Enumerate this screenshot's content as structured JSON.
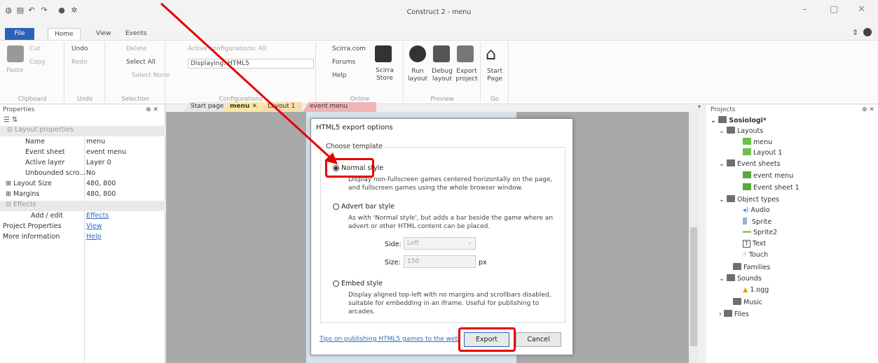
{
  "window": {
    "title": "Construct 2 - menu",
    "minimize": "–",
    "restore": "▢",
    "close": "✕"
  },
  "ribbon_tabs": [
    "File",
    "Home",
    "View",
    "Events"
  ],
  "ribbon": {
    "paste": "Paste",
    "cut": "Cut",
    "copy": "Copy",
    "undo": "Undo",
    "redo": "Redo",
    "delete": "Delete",
    "select_all": "Select All",
    "select_none": "Select None",
    "active_config": "Active configurations: All",
    "displaying": "Displaying: HTML5",
    "scirra": "Scirra.com",
    "forums": "Forums",
    "help": "Help",
    "store": "Scirra Store",
    "run": "Run layout",
    "debug": "Debug layout",
    "export": "Export project",
    "start": "Start Page",
    "groups": {
      "clipboard": "Clipboard",
      "undo": "Undo",
      "selection": "Selection",
      "configurations": "Configurations",
      "online": "Online",
      "preview": "Preview",
      "go": "Go"
    }
  },
  "properties": {
    "title": "Properties",
    "pin": "⊕ ✕",
    "rows": [
      {
        "k": "Layout properties",
        "v": ""
      },
      {
        "k": "Name",
        "v": "menu"
      },
      {
        "k": "Event sheet",
        "v": "event menu"
      },
      {
        "k": "Active layer",
        "v": "Layer 0"
      },
      {
        "k": "Unbounded scro...",
        "v": "No"
      },
      {
        "k": "Layout Size",
        "v": "480, 800"
      },
      {
        "k": "Margins",
        "v": "480, 800"
      },
      {
        "k": "Effects",
        "v": ""
      },
      {
        "k": "Add / edit",
        "v": "Effects"
      },
      {
        "k": "Project Properties",
        "v": "View"
      },
      {
        "k": "More information",
        "v": "Help"
      }
    ]
  },
  "doc_tabs": [
    "Start page",
    "menu",
    "Layout 1",
    "event menu"
  ],
  "dialog": {
    "title": "HTML5 export options",
    "group": "Choose template",
    "opt1": "Normal style",
    "opt1_desc": "Display non-fullscreen games centered horizontally on the page, and fullscreen games using the whole browser window.",
    "opt2": "Advert bar style",
    "opt2_desc": "As with 'Normal style', but adds a bar beside the game where an advert or other HTML content can be placed.",
    "side_label": "Side:",
    "side_value": "Left",
    "size_label": "Size:",
    "size_value": "150",
    "size_unit": "px",
    "opt3": "Embed style",
    "opt3_desc": "Display aligned top-left with no margins and scrollbars disabled, suitable for embedding in an iframe. Useful for publishing to arcades.",
    "tips": "Tips on publishing HTML5 games to the web",
    "export": "Export",
    "cancel": "Cancel"
  },
  "projects": {
    "title": "Projects",
    "project": "Sosiologi*",
    "layouts": "Layouts",
    "layout_items": [
      "menu",
      "Layout 1"
    ],
    "event_sheets": "Event sheets",
    "event_items": [
      "event menu",
      "Event sheet 1"
    ],
    "object_types": "Object types",
    "object_items": [
      "Audio",
      "Sprite",
      "Sprite2",
      "Text",
      "Touch"
    ],
    "families": "Families",
    "sounds": "Sounds",
    "sound_items": [
      "1.ogg"
    ],
    "music": "Music",
    "files": "Files"
  },
  "colors": {
    "accent": "#2a62b8",
    "highlight": "#e50000",
    "layout_bg": "#d6e4ee"
  }
}
